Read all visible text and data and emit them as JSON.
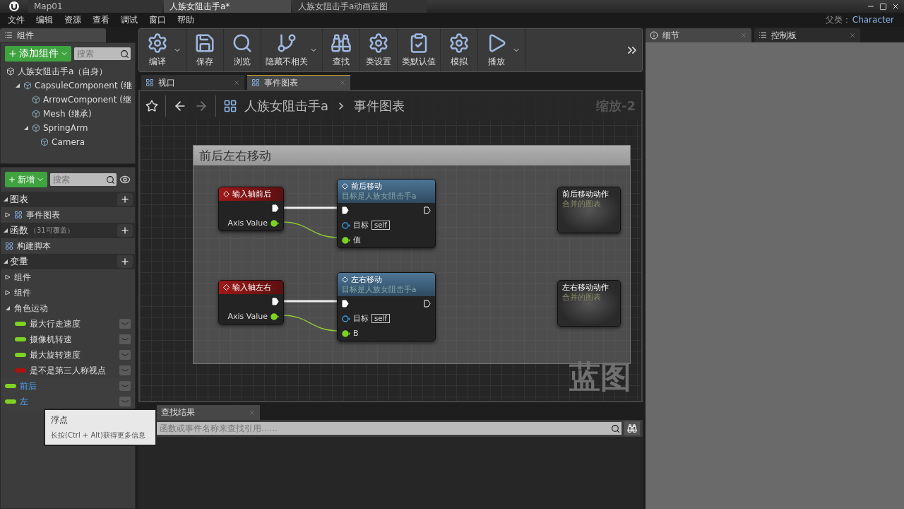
{
  "title_tabs": [
    {
      "label": "Map01",
      "selected": false
    },
    {
      "label": "人族女阻击手a*",
      "selected": true
    },
    {
      "label": "人族女阻击手a动画蓝图",
      "selected": false
    }
  ],
  "menu": [
    "文件",
    "编辑",
    "资源",
    "查看",
    "调试",
    "窗口",
    "帮助"
  ],
  "parent_class": {
    "label": "父类：",
    "value": "Character"
  },
  "components_panel": {
    "tab": "组件",
    "add_button": "添加组件",
    "search_placeholder": "搜索",
    "root": "人族女阻击手a（自身）",
    "tree": [
      {
        "label": "CapsuleComponent (继",
        "expanded": true,
        "children": [
          {
            "label": "ArrowComponent (继"
          },
          {
            "label": "Mesh (继承)"
          },
          {
            "label": "SpringArm",
            "expanded": true,
            "children": [
              {
                "label": "Camera"
              }
            ]
          }
        ]
      }
    ]
  },
  "my_blueprint": {
    "new_button": "新增",
    "search_placeholder": "搜索",
    "sections": [
      {
        "title": "图表",
        "items": [
          {
            "label": "事件图表",
            "expanded": false
          }
        ]
      },
      {
        "title": "函数",
        "note": "（31可覆盖）",
        "items": [
          {
            "label": "构建脚本"
          }
        ]
      },
      {
        "title": "变量",
        "groups": [
          {
            "label": "组件",
            "expanded": false
          },
          {
            "label": "组件",
            "expanded": false
          },
          {
            "label": "角色运动",
            "expanded": true,
            "vars": [
              {
                "label": "最大行走速度",
                "color": "#7ed321",
                "selected": false
              },
              {
                "label": "摄像机转速",
                "color": "#7ed321",
                "selected": false
              },
              {
                "label": "最大旋转速度",
                "color": "#7ed321",
                "selected": false
              },
              {
                "label": "是不是第三人称视点",
                "color": "#b01010",
                "selected": false
              }
            ]
          }
        ],
        "vars": [
          {
            "label": "前后",
            "color": "#7ed321",
            "selected": true
          },
          {
            "label": "左",
            "color": "#7ed321",
            "selected": true
          }
        ]
      }
    ]
  },
  "tooltip": {
    "title": "浮点",
    "hint": "长按(Ctrl + Alt)获得更多信息"
  },
  "toolbar": [
    {
      "label": "编译",
      "dropdown": true
    },
    {
      "label": "保存",
      "dropdown": false
    },
    {
      "label": "浏览",
      "dropdown": false
    },
    {
      "label": "隐藏不相关",
      "dropdown": true
    },
    {
      "label": "查找",
      "dropdown": false
    },
    {
      "label": "类设置",
      "dropdown": false
    },
    {
      "label": "类默认值",
      "dropdown": false
    },
    {
      "label": "模拟",
      "dropdown": false
    },
    {
      "label": "播放",
      "dropdown": true
    }
  ],
  "editor_tabs": [
    {
      "label": "视口",
      "selected": false
    },
    {
      "label": "事件图表",
      "selected": true
    }
  ],
  "graph": {
    "breadcrumb": [
      "人族女阻击手a",
      "事件图表"
    ],
    "zoom": "缩放-2",
    "watermark": "蓝图",
    "comment": "前后左右移动",
    "rows": [
      {
        "event": {
          "title": "输入轴前后",
          "pin": "Axis Value"
        },
        "function": {
          "title": "前后移动",
          "subtitle": "目标是人族女阻击手a",
          "target_label": "目标",
          "target_value": "self",
          "value_pin": "值"
        },
        "collapsed": {
          "title": "前后移动动作",
          "subtitle": "合并的图表"
        }
      },
      {
        "event": {
          "title": "输入轴左右",
          "pin": "Axis Value"
        },
        "function": {
          "title": "左右移动",
          "subtitle": "目标是人族女阻击手a",
          "target_label": "目标",
          "target_value": "self",
          "value_pin": "B"
        },
        "collapsed": {
          "title": "左右移动动作",
          "subtitle": "合并的图表"
        }
      }
    ]
  },
  "find_results": {
    "tab": "查找结果",
    "placeholder": "函数或事件名称来查找引用......"
  },
  "details_tabs": [
    {
      "label": "细节",
      "selected": true
    },
    {
      "label": "控制板",
      "selected": false
    }
  ]
}
